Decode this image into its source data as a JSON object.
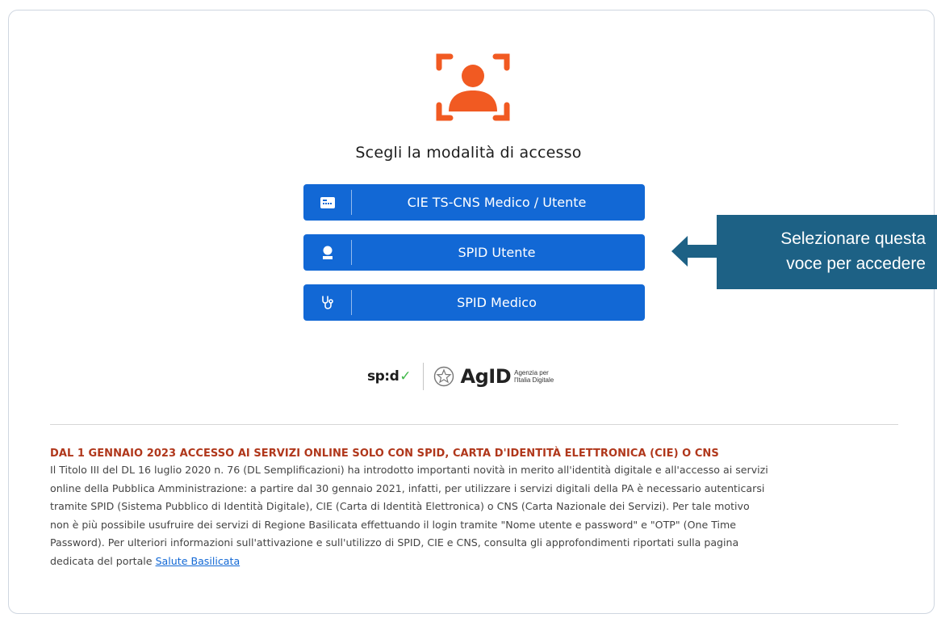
{
  "login": {
    "title": "Scegli la modalità di accesso",
    "buttons": [
      {
        "label": "CIE TS-CNS Medico / Utente",
        "icon": "id-card-icon"
      },
      {
        "label": "SPID Utente",
        "icon": "user-icon"
      },
      {
        "label": "SPID Medico",
        "icon": "stethoscope-icon"
      }
    ]
  },
  "callout": {
    "line1": "Selezionare questa",
    "line2": "voce per accedere"
  },
  "logos": {
    "spid": "sp:d",
    "agid": "AgID",
    "agid_sub1": "Agenzia per",
    "agid_sub2": "l'Italia Digitale"
  },
  "notice": {
    "title": "DAL 1 GENNAIO 2023 ACCESSO AI SERVIZI ONLINE SOLO CON SPID, CARTA D'IDENTITÀ ELETTRONICA (CIE) O CNS",
    "lines": [
      "Il Titolo III del DL 16 luglio 2020 n. 76 (DL Semplificazioni) ha introdotto importanti novità in merito all'identità digitale e all'accesso ai servizi",
      "online della Pubblica Amministrazione: a partire dal 30 gennaio 2021, infatti, per utilizzare i servizi digitali della PA è necessario autenticarsi",
      "tramite SPID (Sistema Pubblico di Identità Digitale), CIE (Carta di Identità Elettronica) o CNS (Carta Nazionale dei Servizi). Per tale motivo",
      "non è più possibile usufruire dei servizi di Regione Basilicata effettuando il login tramite \"Nome utente e password\" e \"OTP\" (One Time",
      "Password). Per ulteriori informazioni sull'attivazione e sull'utilizzo di SPID, CIE e CNS, consulta gli approfondimenti riportati sulla pagina"
    ],
    "last_line_prefix": "dedicata del portale ",
    "link_text": "Salute Basilicata"
  },
  "colors": {
    "accent": "#1268d5",
    "brand_orange": "#f15a22",
    "callout_bg": "#1d6185",
    "notice_title": "#b0371b"
  }
}
